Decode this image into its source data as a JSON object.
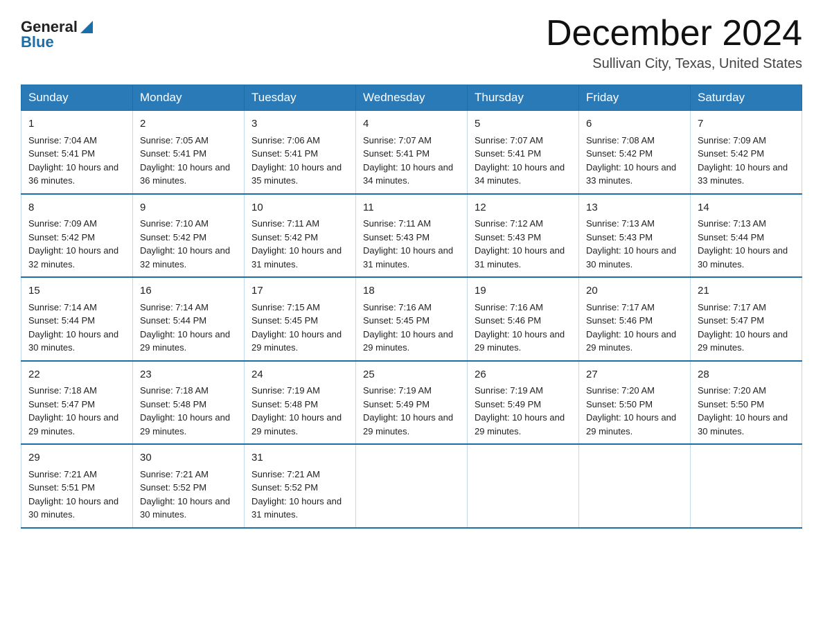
{
  "header": {
    "logo_general": "General",
    "logo_blue": "Blue",
    "month_title": "December 2024",
    "location": "Sullivan City, Texas, United States"
  },
  "days_of_week": [
    "Sunday",
    "Monday",
    "Tuesday",
    "Wednesday",
    "Thursday",
    "Friday",
    "Saturday"
  ],
  "weeks": [
    [
      {
        "day": "1",
        "sunrise": "7:04 AM",
        "sunset": "5:41 PM",
        "daylight": "10 hours and 36 minutes."
      },
      {
        "day": "2",
        "sunrise": "7:05 AM",
        "sunset": "5:41 PM",
        "daylight": "10 hours and 36 minutes."
      },
      {
        "day": "3",
        "sunrise": "7:06 AM",
        "sunset": "5:41 PM",
        "daylight": "10 hours and 35 minutes."
      },
      {
        "day": "4",
        "sunrise": "7:07 AM",
        "sunset": "5:41 PM",
        "daylight": "10 hours and 34 minutes."
      },
      {
        "day": "5",
        "sunrise": "7:07 AM",
        "sunset": "5:41 PM",
        "daylight": "10 hours and 34 minutes."
      },
      {
        "day": "6",
        "sunrise": "7:08 AM",
        "sunset": "5:42 PM",
        "daylight": "10 hours and 33 minutes."
      },
      {
        "day": "7",
        "sunrise": "7:09 AM",
        "sunset": "5:42 PM",
        "daylight": "10 hours and 33 minutes."
      }
    ],
    [
      {
        "day": "8",
        "sunrise": "7:09 AM",
        "sunset": "5:42 PM",
        "daylight": "10 hours and 32 minutes."
      },
      {
        "day": "9",
        "sunrise": "7:10 AM",
        "sunset": "5:42 PM",
        "daylight": "10 hours and 32 minutes."
      },
      {
        "day": "10",
        "sunrise": "7:11 AM",
        "sunset": "5:42 PM",
        "daylight": "10 hours and 31 minutes."
      },
      {
        "day": "11",
        "sunrise": "7:11 AM",
        "sunset": "5:43 PM",
        "daylight": "10 hours and 31 minutes."
      },
      {
        "day": "12",
        "sunrise": "7:12 AM",
        "sunset": "5:43 PM",
        "daylight": "10 hours and 31 minutes."
      },
      {
        "day": "13",
        "sunrise": "7:13 AM",
        "sunset": "5:43 PM",
        "daylight": "10 hours and 30 minutes."
      },
      {
        "day": "14",
        "sunrise": "7:13 AM",
        "sunset": "5:44 PM",
        "daylight": "10 hours and 30 minutes."
      }
    ],
    [
      {
        "day": "15",
        "sunrise": "7:14 AM",
        "sunset": "5:44 PM",
        "daylight": "10 hours and 30 minutes."
      },
      {
        "day": "16",
        "sunrise": "7:14 AM",
        "sunset": "5:44 PM",
        "daylight": "10 hours and 29 minutes."
      },
      {
        "day": "17",
        "sunrise": "7:15 AM",
        "sunset": "5:45 PM",
        "daylight": "10 hours and 29 minutes."
      },
      {
        "day": "18",
        "sunrise": "7:16 AM",
        "sunset": "5:45 PM",
        "daylight": "10 hours and 29 minutes."
      },
      {
        "day": "19",
        "sunrise": "7:16 AM",
        "sunset": "5:46 PM",
        "daylight": "10 hours and 29 minutes."
      },
      {
        "day": "20",
        "sunrise": "7:17 AM",
        "sunset": "5:46 PM",
        "daylight": "10 hours and 29 minutes."
      },
      {
        "day": "21",
        "sunrise": "7:17 AM",
        "sunset": "5:47 PM",
        "daylight": "10 hours and 29 minutes."
      }
    ],
    [
      {
        "day": "22",
        "sunrise": "7:18 AM",
        "sunset": "5:47 PM",
        "daylight": "10 hours and 29 minutes."
      },
      {
        "day": "23",
        "sunrise": "7:18 AM",
        "sunset": "5:48 PM",
        "daylight": "10 hours and 29 minutes."
      },
      {
        "day": "24",
        "sunrise": "7:19 AM",
        "sunset": "5:48 PM",
        "daylight": "10 hours and 29 minutes."
      },
      {
        "day": "25",
        "sunrise": "7:19 AM",
        "sunset": "5:49 PM",
        "daylight": "10 hours and 29 minutes."
      },
      {
        "day": "26",
        "sunrise": "7:19 AM",
        "sunset": "5:49 PM",
        "daylight": "10 hours and 29 minutes."
      },
      {
        "day": "27",
        "sunrise": "7:20 AM",
        "sunset": "5:50 PM",
        "daylight": "10 hours and 29 minutes."
      },
      {
        "day": "28",
        "sunrise": "7:20 AM",
        "sunset": "5:50 PM",
        "daylight": "10 hours and 30 minutes."
      }
    ],
    [
      {
        "day": "29",
        "sunrise": "7:21 AM",
        "sunset": "5:51 PM",
        "daylight": "10 hours and 30 minutes."
      },
      {
        "day": "30",
        "sunrise": "7:21 AM",
        "sunset": "5:52 PM",
        "daylight": "10 hours and 30 minutes."
      },
      {
        "day": "31",
        "sunrise": "7:21 AM",
        "sunset": "5:52 PM",
        "daylight": "10 hours and 31 minutes."
      },
      null,
      null,
      null,
      null
    ]
  ],
  "labels": {
    "sunrise": "Sunrise:",
    "sunset": "Sunset:",
    "daylight": "Daylight:"
  }
}
